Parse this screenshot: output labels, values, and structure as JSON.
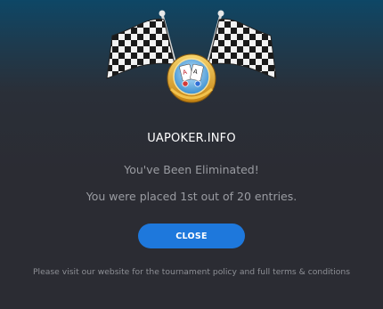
{
  "dialog": {
    "emblem_icon": "checkered-flags-trophy-icon",
    "site_name": "UAPOKER.INFO",
    "eliminated_text": "You've Been Eliminated!",
    "placement_text": "You were placed 1st out of 20 entries.",
    "close_label": "CLOSE",
    "footer_note": "Please visit our website for the tournament policy and full terms & conditions"
  },
  "colors": {
    "background_top": "#0e4766",
    "background_bottom": "#2b2c33",
    "button": "#1e78dc",
    "title_text": "#ffffff",
    "body_text": "#9a9ca2",
    "medal_gold": "#e2a82b",
    "medal_blue": "#5ab0e8"
  }
}
